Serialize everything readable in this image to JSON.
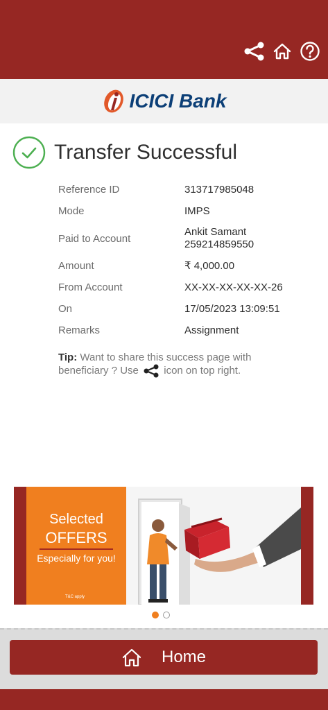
{
  "header": {
    "icons": [
      "share-icon",
      "home-icon",
      "help-icon"
    ],
    "bg_color": "#962723"
  },
  "logo": {
    "text": "ICICI Bank"
  },
  "status": {
    "title": "Transfer Successful",
    "color": "#4caf50"
  },
  "details": [
    {
      "label": "Reference ID",
      "value": "313717985048"
    },
    {
      "label": "Mode",
      "value": "IMPS"
    },
    {
      "label": "Paid to Account",
      "value": "Ankit Samant",
      "value2": "259214859550"
    },
    {
      "label": "Amount",
      "value": "₹ 4,000.00"
    },
    {
      "label": "From Account",
      "value": "XX-XX-XX-XX-XX-26"
    },
    {
      "label": "On",
      "value": "17/05/2023 13:09:51"
    },
    {
      "label": "Remarks",
      "value": "Assignment"
    }
  ],
  "tip": {
    "label": "Tip:",
    "text_before": " Want to share this success page with beneficiary ? Use ",
    "text_after": " icon on top right."
  },
  "banner": {
    "line1": "Selected",
    "line2": "OFFERS",
    "line3": "Especially for you!",
    "tc": "T&C apply",
    "accent": "#f07f1f"
  },
  "carousel": {
    "active_index": 0,
    "count": 2
  },
  "bottom": {
    "home_label": "Home"
  }
}
